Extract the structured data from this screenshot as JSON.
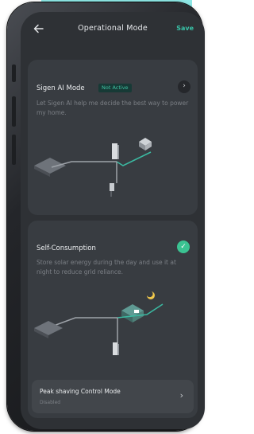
{
  "header": {
    "title": "Operational Mode",
    "save_label": "Save"
  },
  "ai_mode": {
    "title": "Sigen AI Mode",
    "status_badge": "Not Active",
    "description": "Let Sigen AI help me decide the best way to power my home."
  },
  "self_consumption": {
    "title": "Self-Consumption",
    "selected": true,
    "description": "Store solar energy during the day and use it at night to reduce grid reliance."
  },
  "peak_shaving": {
    "title": "Peak shaving Control Mode",
    "status": "Disabled"
  },
  "icons": {
    "back": "back-arrow-icon",
    "chevron": "chevron-right-icon",
    "check": "check-circle-icon",
    "moon": "moon-icon"
  },
  "colors": {
    "accent": "#38c1a6",
    "screen_bg": "#2e3135",
    "card_bg": "#383c41",
    "flow_line": "#3bb9a1",
    "moon": "#f2c94c"
  }
}
